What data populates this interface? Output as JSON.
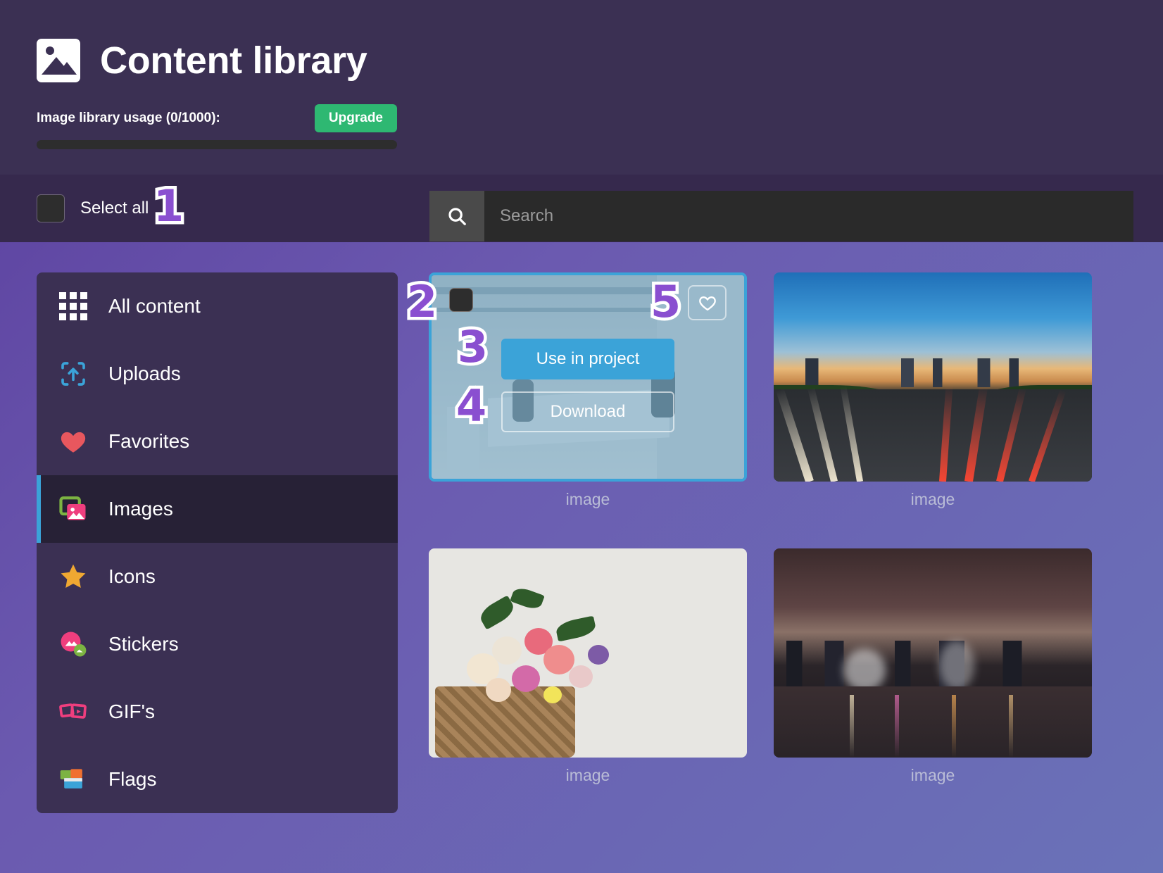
{
  "header": {
    "title": "Content library",
    "logo_icon": "image-placeholder-icon",
    "usage_label": "Image library usage (0/1000):",
    "upgrade_label": "Upgrade",
    "usage_percent": 0,
    "usage_used": 0,
    "usage_total": 1000
  },
  "toolbar": {
    "select_all_label": "Select all",
    "select_all_checked": false,
    "search_icon": "search-icon",
    "search_value": "",
    "search_placeholder": "Search"
  },
  "sidebar": {
    "items": [
      {
        "label": "All content",
        "icon": "grid-icon",
        "active": false
      },
      {
        "label": "Uploads",
        "icon": "upload-icon",
        "active": false
      },
      {
        "label": "Favorites",
        "icon": "heart-icon",
        "active": false
      },
      {
        "label": "Images",
        "icon": "images-icon",
        "active": true
      },
      {
        "label": "Icons",
        "icon": "star-icon",
        "active": false
      },
      {
        "label": "Stickers",
        "icon": "stickers-icon",
        "active": false
      },
      {
        "label": "GIF's",
        "icon": "gif-icon",
        "active": false
      },
      {
        "label": "Flags",
        "icon": "flags-icon",
        "active": false
      }
    ]
  },
  "gallery": {
    "items": [
      {
        "caption": "image",
        "scene": "office",
        "selected": true
      },
      {
        "caption": "image",
        "scene": "highway",
        "selected": false
      },
      {
        "caption": "image",
        "scene": "flowers",
        "selected": false
      },
      {
        "caption": "image",
        "scene": "hongkong",
        "selected": false
      }
    ],
    "hover_card": {
      "checkbox_name": "card-select-checkbox",
      "favorite_icon": "heart-outline-icon",
      "use_in_project_label": "Use in project",
      "download_label": "Download"
    }
  },
  "annotations": {
    "badges": [
      {
        "number": "1",
        "target": "select-all-checkbox"
      },
      {
        "number": "2",
        "target": "card-select-checkbox"
      },
      {
        "number": "3",
        "target": "use-in-project-button"
      },
      {
        "number": "4",
        "target": "download-button"
      },
      {
        "number": "5",
        "target": "favorite-button"
      }
    ]
  },
  "colors": {
    "header_bg": "#3b3053",
    "toolbar_bg": "#36294d",
    "sidebar_bg": "#3b3053",
    "sidebar_active_bg": "#272136",
    "accent_blue": "#3ba3d8",
    "upgrade_green": "#2eb872",
    "badge_purple": "#8a4fd0",
    "page_gradient_from": "#5b3f9e",
    "page_gradient_to": "#6a72b8"
  }
}
